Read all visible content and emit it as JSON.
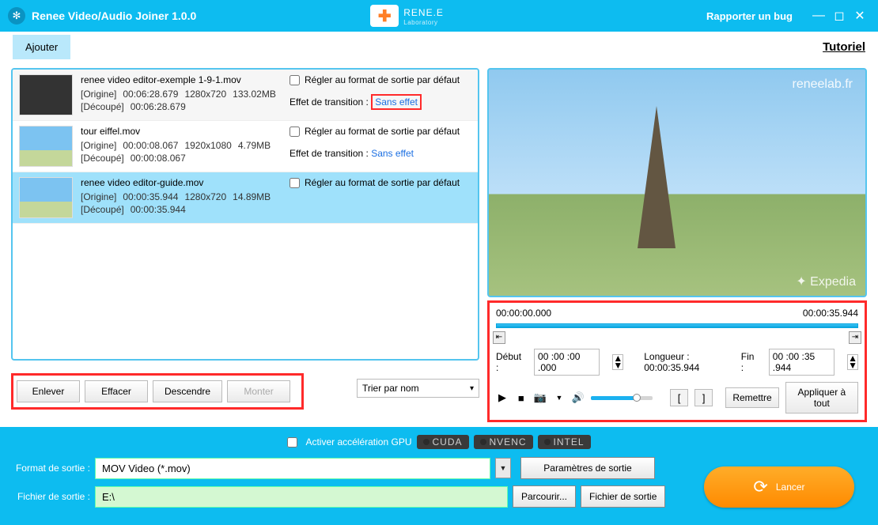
{
  "titlebar": {
    "app_title": "Renee Video/Audio Joiner 1.0.0",
    "logo_text": "RENE.E",
    "logo_sub": "Laboratory",
    "bug": "Rapporter un bug"
  },
  "topbar": {
    "add": "Ajouter",
    "tutoriel": "Tutoriel"
  },
  "files": [
    {
      "name": "renee video editor-exemple 1-9-1.mov",
      "origin_label": "[Origine]",
      "origin_time": "00:06:28.679",
      "origin_res": "1280x720",
      "origin_size": "133.02MB",
      "cut_label": "[Découpé]",
      "cut_time": "00:06:28.679",
      "chk_label": "Régler au format de sortie par défaut",
      "eff_label": "Effet de transition :",
      "eff_value": "Sans effet",
      "eff_boxed": true
    },
    {
      "name": "tour eiffel.mov",
      "origin_label": "[Origine]",
      "origin_time": "00:00:08.067",
      "origin_res": "1920x1080",
      "origin_size": "4.79MB",
      "cut_label": "[Découpé]",
      "cut_time": "00:00:08.067",
      "chk_label": "Régler au format de sortie par défaut",
      "eff_label": "Effet de transition :",
      "eff_value": "Sans effet",
      "eff_boxed": false
    },
    {
      "name": "renee video editor-guide.mov",
      "origin_label": "[Origine]",
      "origin_time": "00:00:35.944",
      "origin_res": "1280x720",
      "origin_size": "14.89MB",
      "cut_label": "[Découpé]",
      "cut_time": "00:00:35.944",
      "chk_label": "Régler au format de sortie par défaut"
    }
  ],
  "actions": {
    "remove": "Enlever",
    "clear": "Effacer",
    "down": "Descendre",
    "up": "Monter",
    "sort": "Trier par nom"
  },
  "preview": {
    "watermark": "reneelab.fr",
    "expedia": "✦ Expedia"
  },
  "trim": {
    "start_time": "00:00:00.000",
    "end_time": "00:00:35.944",
    "start_label": "Début :",
    "start_value": "00 :00 :00 .000",
    "len_label": "Longueur : 00:00:35.944",
    "end_label": "Fin :",
    "end_value": "00 :00 :35 .944",
    "reset": "Remettre",
    "apply_all": "Appliquer à tout"
  },
  "gpu": {
    "label": "Activer accélération GPU",
    "cuda": "CUDA",
    "nvenc": "NVENC",
    "intel": "INTEL"
  },
  "output": {
    "format_label": "Format de sortie :",
    "format_value": "MOV Video (*.mov)",
    "format_settings": "Paramètres de sortie",
    "file_label": "Fichier de sortie :",
    "file_value": "E:\\",
    "browse": "Parcourir...",
    "open_folder": "Fichier de sortie"
  },
  "launch": "Lancer"
}
